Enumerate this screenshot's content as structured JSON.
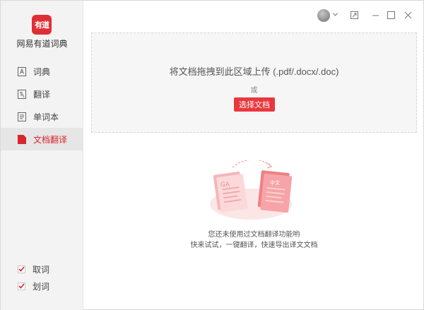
{
  "app": {
    "logo_text": "有道",
    "name": "网易有道词典"
  },
  "sidebar": {
    "items": [
      {
        "label": "词典",
        "icon": "dictionary-icon",
        "active": false
      },
      {
        "label": "翻译",
        "icon": "translate-icon",
        "active": false
      },
      {
        "label": "单词本",
        "icon": "wordbook-icon",
        "active": false
      },
      {
        "label": "文档翻译",
        "icon": "document-icon",
        "active": true
      }
    ],
    "options": [
      {
        "label": "取词",
        "checked": true
      },
      {
        "label": "划词",
        "checked": true
      }
    ]
  },
  "titlebar": {
    "icons": [
      "avatar",
      "chevron-down-icon",
      "mini-mode-icon",
      "minimize-icon",
      "maximize-icon",
      "close-icon"
    ]
  },
  "dropzone": {
    "instruction": "将文档拖拽到此区域上传 (.pdf/.docx/.doc)",
    "or": "或",
    "button_label": "选择文档"
  },
  "illustration": {
    "source_doc_label": "GA",
    "target_doc_label": "中文"
  },
  "empty_state": {
    "line1": "您还未使用过文档翻译功能哟",
    "line2": "快来试试，一键翻译，快速导出译文文档"
  },
  "colors": {
    "accent": "#e02e35",
    "sidebar_bg": "#f3f3f3",
    "dropzone_bg": "#f6f6f6"
  }
}
